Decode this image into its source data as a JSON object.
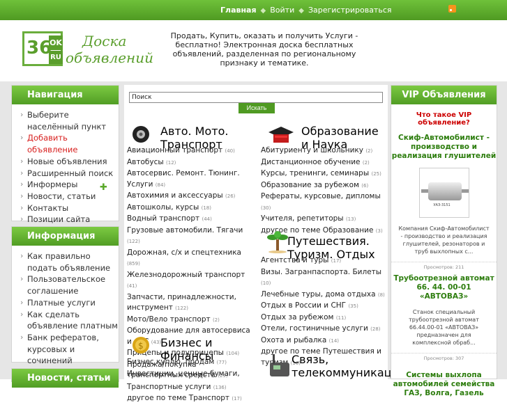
{
  "topnav": {
    "home": "Главная",
    "login": "Войти",
    "register": "Зарегистрироваться"
  },
  "logo": {
    "number": "36",
    "ok": "OK",
    "ru": "RU",
    "line1": "Доска",
    "line2": "объявлений"
  },
  "tagline": "Продать, Купить, оказать и получить Услуги - бесплатно! Электронная доска бесплатных объявлений, разделенная по региональному признаку и тематике.",
  "navigation": {
    "title": "Навигация",
    "items": [
      "Выберите населённый пункт",
      "Добавить объявление",
      "Новые объявления",
      "Расширенный поиск",
      "Информеры",
      "Новости, статьи",
      "Контакты",
      "Позиции сайта"
    ]
  },
  "information": {
    "title": "Информация",
    "items": [
      "Как правильно подать объявление",
      "Пользовательское соглашение",
      "Платные услуги",
      "Как сделать объявление платным",
      "Банк рефератов, курсовых и сочинений"
    ]
  },
  "news": {
    "title": "Новости, статьи"
  },
  "search": {
    "placeholder": "Поиск",
    "button": "Искать"
  },
  "categories": {
    "auto": {
      "title": "Авто. Мото. Транспорт",
      "items": [
        {
          "name": "Авиационный транспорт",
          "count": "(40)"
        },
        {
          "name": "Автобусы",
          "count": "(12)"
        },
        {
          "name": "Автосервис. Ремонт. Тюнинг. Услуги",
          "count": "(84)"
        },
        {
          "name": "Автохимия и аксессуары",
          "count": "(26)"
        },
        {
          "name": "Автошколы, курсы",
          "count": "(18)"
        },
        {
          "name": "Водный транспорт",
          "count": "(44)"
        },
        {
          "name": "Грузовые автомобили. Тягачи",
          "count": "(122)"
        },
        {
          "name": "Дорожная, с/х и спецтехника",
          "count": "(859)"
        },
        {
          "name": "Железнодорожный транспорт",
          "count": "(41)"
        },
        {
          "name": "Запчасти, принадлежности, инструмент",
          "count": "(122)"
        },
        {
          "name": "Мото/Вело транспорт",
          "count": "(2)"
        },
        {
          "name": "Оборудование для автосервиса и АЗС",
          "count": "(43)"
        },
        {
          "name": "Прицепы и полуприцепы",
          "count": "(104)"
        },
        {
          "name": "Продажа/покупка транспортных средств",
          "count": "(29)"
        },
        {
          "name": "Транспортные услуги",
          "count": "(136)"
        },
        {
          "name": "другое по теме Транспорт",
          "count": "(17)"
        }
      ]
    },
    "business": {
      "title": "Бизнес и Финансы",
      "items": [
        {
          "name": "Бизнес куплю, продам",
          "count": "(77)"
        },
        {
          "name": "Инвестиции, ценные бумаги,",
          "count": ""
        }
      ]
    },
    "education": {
      "title": "Образование и Наука",
      "items": [
        {
          "name": "Абитуриенту и школьнику",
          "count": "(2)"
        },
        {
          "name": "Дистанционное обучение",
          "count": "(2)"
        },
        {
          "name": "Курсы, тренинги, семинары",
          "count": "(25)"
        },
        {
          "name": "Образование за рубежом",
          "count": "(6)"
        },
        {
          "name": "Рефераты, курсовые, дипломы",
          "count": "(30)"
        },
        {
          "name": "Учителя, репетиторы",
          "count": "(13)"
        },
        {
          "name": "другое по теме Образование",
          "count": "(3)"
        }
      ]
    },
    "travel": {
      "title": "Путешествия. Туризм. Отдых",
      "items": [
        {
          "name": "Агентства и туры",
          "count": "(17)"
        },
        {
          "name": "Визы. Загранпаспорта. Билеты",
          "count": "(10)"
        },
        {
          "name": "Лечебные туры, дома отдыха",
          "count": "(8)"
        },
        {
          "name": "Отдых в России и СНГ",
          "count": "(35)"
        },
        {
          "name": "Отдых за рубежом",
          "count": "(11)"
        },
        {
          "name": "Отели, гостиничные услуги",
          "count": "(28)"
        },
        {
          "name": "Охота и рыбалка",
          "count": "(14)"
        },
        {
          "name": "другое по теме Путешествия и туризм",
          "count": "(10)"
        }
      ]
    },
    "telecom": {
      "title": "Связь, телекоммуникации"
    }
  },
  "vip": {
    "title": "VIP Объявления",
    "what": "Что такое VIP объявление?",
    "ads": [
      {
        "title": "Скиф-Автомобилист - производство и реализация глушителей",
        "desc": "Компания Скиф-Автомобилист - производство и реализация глушителей, резонаторов и труб выхлопных с...",
        "views": "Просмотров: 211",
        "img_label": "УАЗ-3151"
      },
      {
        "title": "Трубоотрезной автомат 66. 44. 00-01 «АВТОВАЗ»",
        "desc": "Станок специальный трубоотрезной автомат 66.44.00-01 «АВТОВАЗ» предназначен для комплексной обраб...",
        "views": "Просмотров: 307"
      },
      {
        "title": "Системы выхлопа автомобилей семейства ГАЗ, Волга, Газель",
        "desc": "",
        "views": ""
      }
    ]
  }
}
